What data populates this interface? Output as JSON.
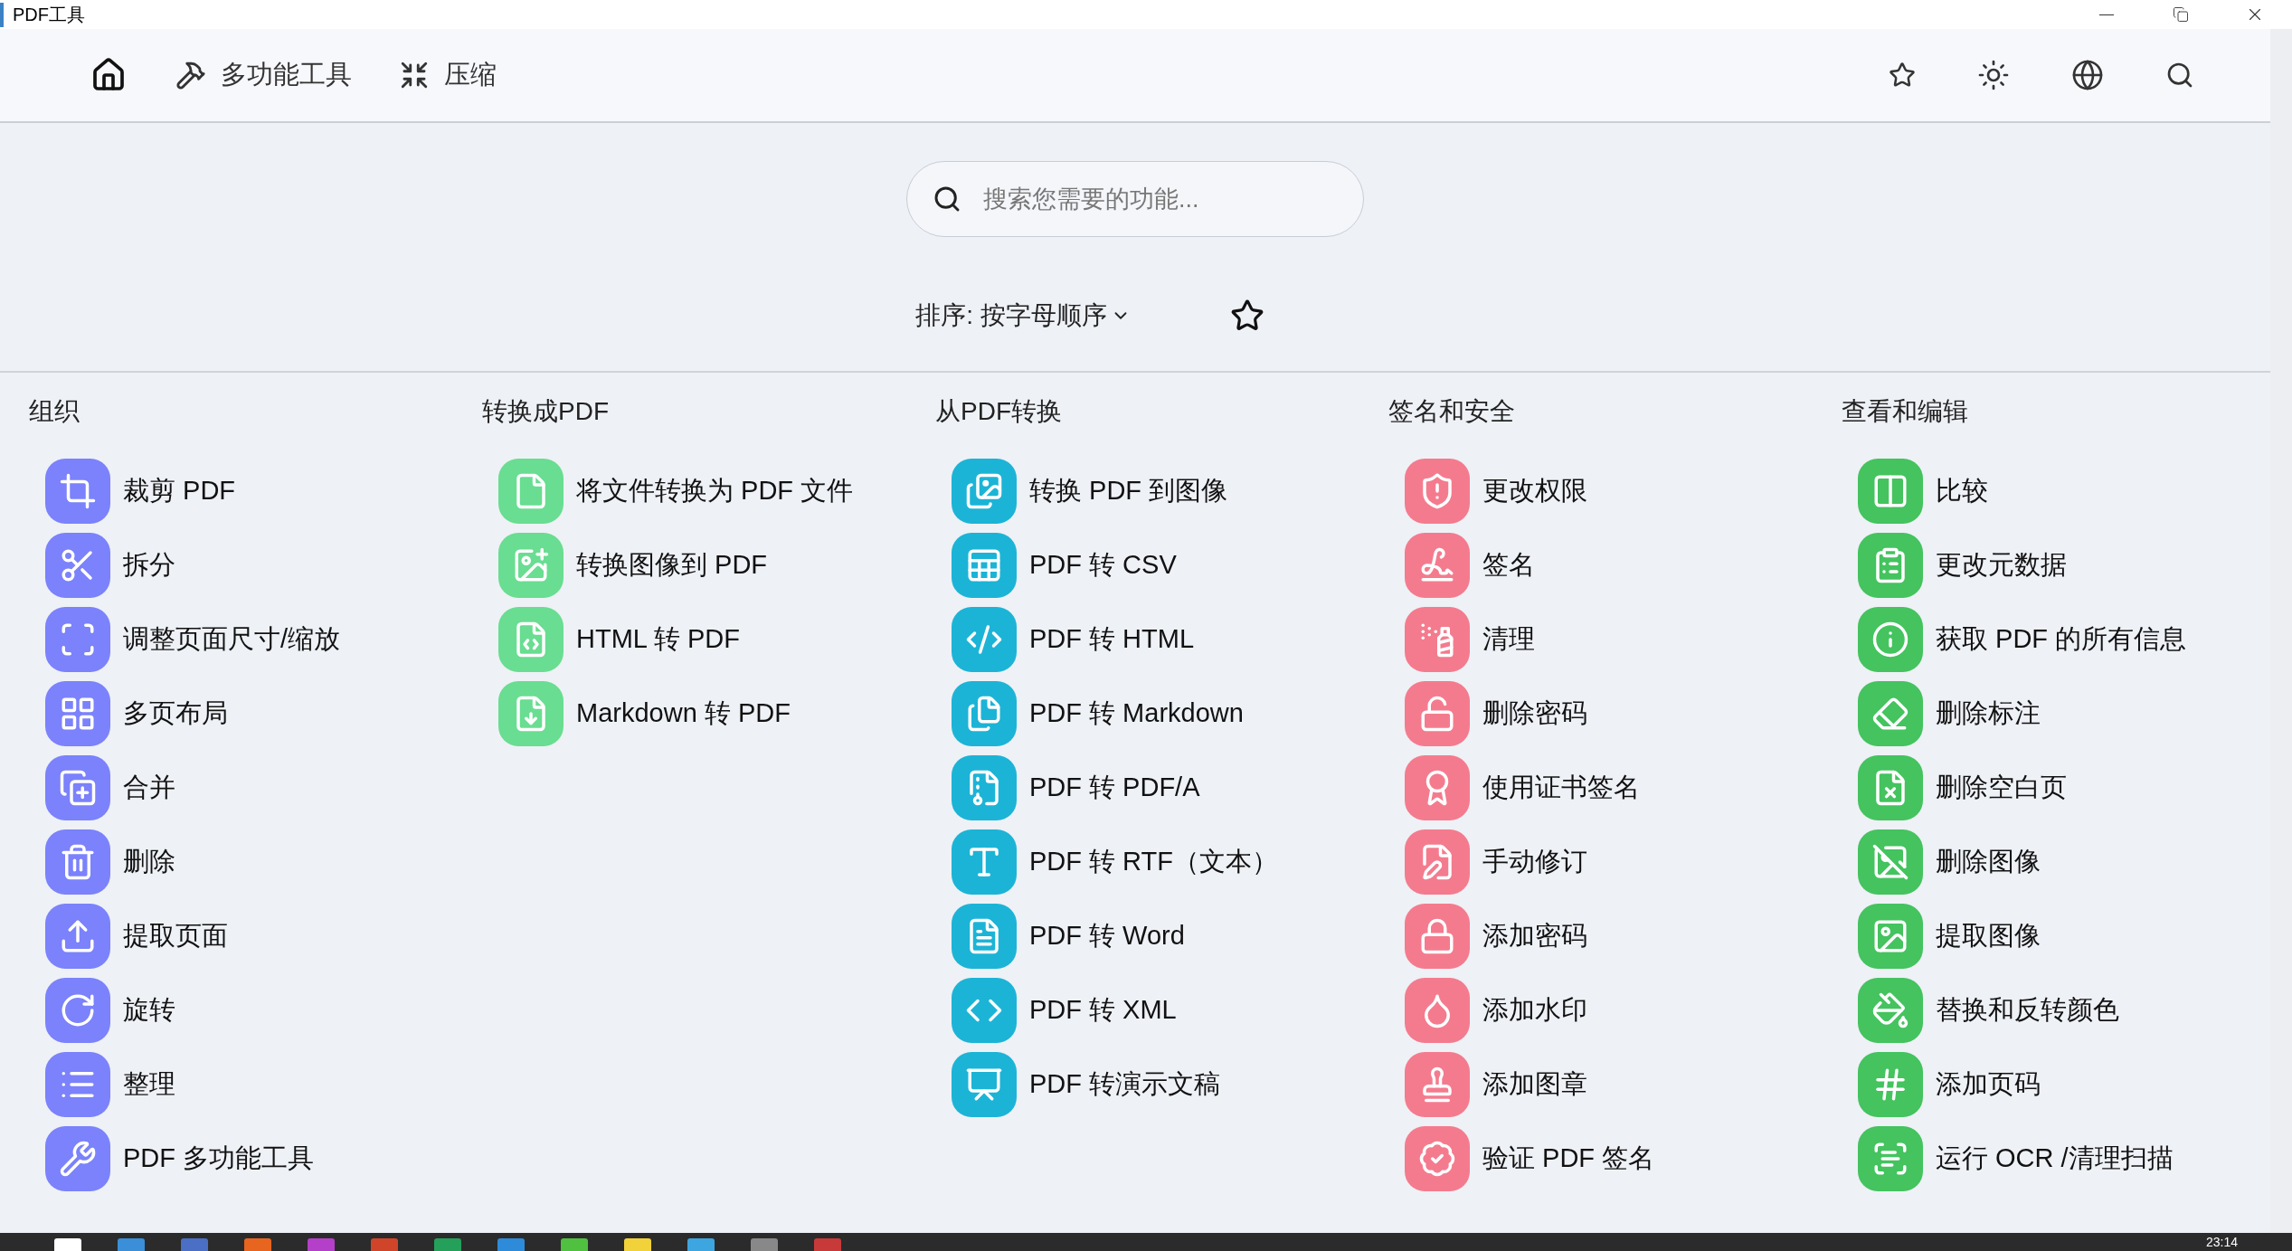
{
  "window": {
    "title": "PDF工具"
  },
  "nav": [
    {
      "label": "多功能工具"
    },
    {
      "label": "压缩"
    }
  ],
  "search": {
    "placeholder": "搜索您需要的功能..."
  },
  "sort": {
    "label": "排序: 按字母顺序"
  },
  "categories": [
    {
      "title": "组织",
      "color": "#7b82fb",
      "tools": [
        {
          "label": "裁剪 PDF"
        },
        {
          "label": "拆分"
        },
        {
          "label": "调整页面尺寸/缩放"
        },
        {
          "label": "多页布局"
        },
        {
          "label": "合并"
        },
        {
          "label": "删除"
        },
        {
          "label": "提取页面"
        },
        {
          "label": "旋转"
        },
        {
          "label": "整理"
        },
        {
          "label": "PDF 多功能工具"
        }
      ]
    },
    {
      "title": "转换成PDF",
      "color": "#69dd91",
      "tools": [
        {
          "label": "将文件转换为 PDF 文件"
        },
        {
          "label": "转换图像到 PDF"
        },
        {
          "label": "HTML 转 PDF"
        },
        {
          "label": "Markdown 转 PDF"
        }
      ]
    },
    {
      "title": "从PDF转换",
      "color": "#1cb4d6",
      "tools": [
        {
          "label": "转换 PDF 到图像"
        },
        {
          "label": "PDF 转 CSV"
        },
        {
          "label": "PDF 转 HTML"
        },
        {
          "label": "PDF 转 Markdown"
        },
        {
          "label": "PDF 转 PDF/A"
        },
        {
          "label": "PDF 转 RTF（文本）"
        },
        {
          "label": "PDF 转 Word"
        },
        {
          "label": "PDF 转 XML"
        },
        {
          "label": "PDF 转演示文稿"
        }
      ]
    },
    {
      "title": "签名和安全",
      "color": "#f47b8e",
      "tools": [
        {
          "label": "更改权限"
        },
        {
          "label": "签名"
        },
        {
          "label": "清理"
        },
        {
          "label": "删除密码"
        },
        {
          "label": "使用证书签名"
        },
        {
          "label": "手动修订"
        },
        {
          "label": "添加密码"
        },
        {
          "label": "添加水印"
        },
        {
          "label": "添加图章"
        },
        {
          "label": "验证 PDF 签名"
        }
      ]
    },
    {
      "title": "查看和编辑",
      "color": "#44c35f",
      "tools": [
        {
          "label": "比较"
        },
        {
          "label": "更改元数据"
        },
        {
          "label": "获取 PDF 的所有信息"
        },
        {
          "label": "删除标注"
        },
        {
          "label": "删除空白页"
        },
        {
          "label": "删除图像"
        },
        {
          "label": "提取图像"
        },
        {
          "label": "替换和反转颜色"
        },
        {
          "label": "添加页码"
        },
        {
          "label": "运行 OCR /清理扫描"
        }
      ]
    }
  ],
  "taskbar": {
    "clock": "23:14"
  }
}
